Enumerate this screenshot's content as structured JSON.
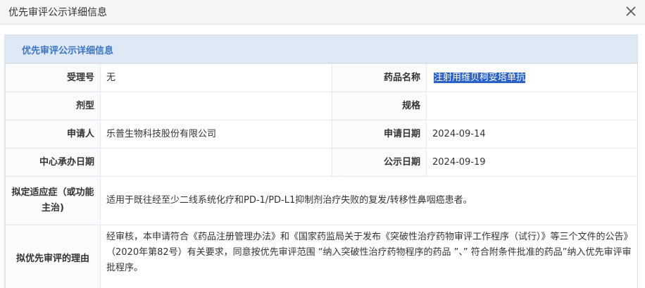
{
  "dialog": {
    "title": "优先审评公示详细信息"
  },
  "panel": {
    "title": "优先审评公示详细信息"
  },
  "fields": {
    "accept_no_label": "受理号",
    "accept_no_value": "无",
    "drug_name_label": "药品名称",
    "drug_name_value": "注射用维贝柯妥塔单抗",
    "dosage_label": "剂型",
    "dosage_value": "",
    "spec_label": "规格",
    "spec_value": "",
    "applicant_label": "申请人",
    "applicant_value": "乐普生物科技股份有限公司",
    "apply_date_label": "申请日期",
    "apply_date_value": "2024-09-14",
    "center_date_label": "中心承办日期",
    "center_date_value": "",
    "publish_date_label": "公示日期",
    "publish_date_value": "2024-09-19",
    "indication_label": "拟定适应症（或功能主治)",
    "indication_value": "适用于既往经至少二线系统化疗和PD-1/PD-L1抑制剂治疗失败的复发/转移性鼻咽癌患者。",
    "reason_label": "拟优先审评的理由",
    "reason_value": "经审核，本申请符合《药品注册管理办法》和《国家药监局关于发布《突破性治疗药物审评工作程序（试行）》等三个文件的公告》（2020年第82号）有关要求，同意按优先审评范围 “纳入突破性治疗药物程序的药品 ”、” 符合附条件批准的药品”纳入优先审评审批程序。"
  },
  "colors": {
    "panel_head_bg": "#dfe9f5",
    "panel_title": "#3a76c4",
    "selection_highlight": "#2a62c9"
  }
}
